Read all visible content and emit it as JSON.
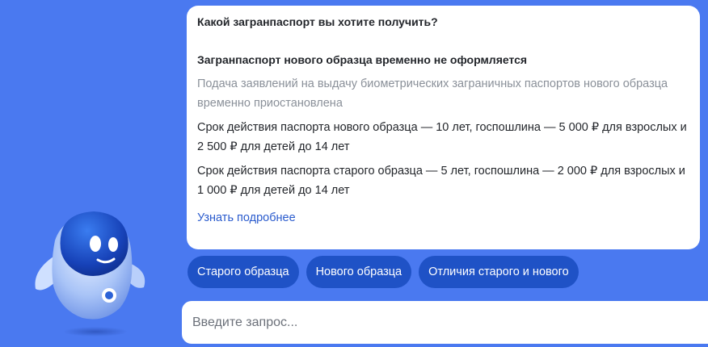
{
  "assistant": {
    "icon": "robot-assistant-icon"
  },
  "message": {
    "question": "Какой загранпаспорт вы хотите получить?",
    "notice_title": "Загранпаспорт нового образца временно не оформляется",
    "notice_text": "Подача заявлений на выдачу биометрических заграничных паспортов нового образца временно приостановлена",
    "new_passport_info": "Срок действия паспорта нового образца — 10 лет, госпошлина — 5 000 ₽ для взрослых и 2 500 ₽ для детей до 14 лет",
    "old_passport_info": "Срок действия паспорта старого образца — 5 лет, госпошлина — 2 000 ₽ для взрослых и 1 000 ₽ для детей до 14 лет",
    "more_link": "Узнать подробнее"
  },
  "quick_replies": [
    {
      "label": "Старого образца"
    },
    {
      "label": "Нового образца"
    },
    {
      "label": "Отличия старого и нового"
    }
  ],
  "input": {
    "placeholder": "Введите запрос...",
    "value": ""
  },
  "colors": {
    "background": "#4a79f0",
    "card": "#ffffff",
    "chip": "#1f52c6",
    "link": "#2a5bcd",
    "muted_text": "#8a9099"
  }
}
